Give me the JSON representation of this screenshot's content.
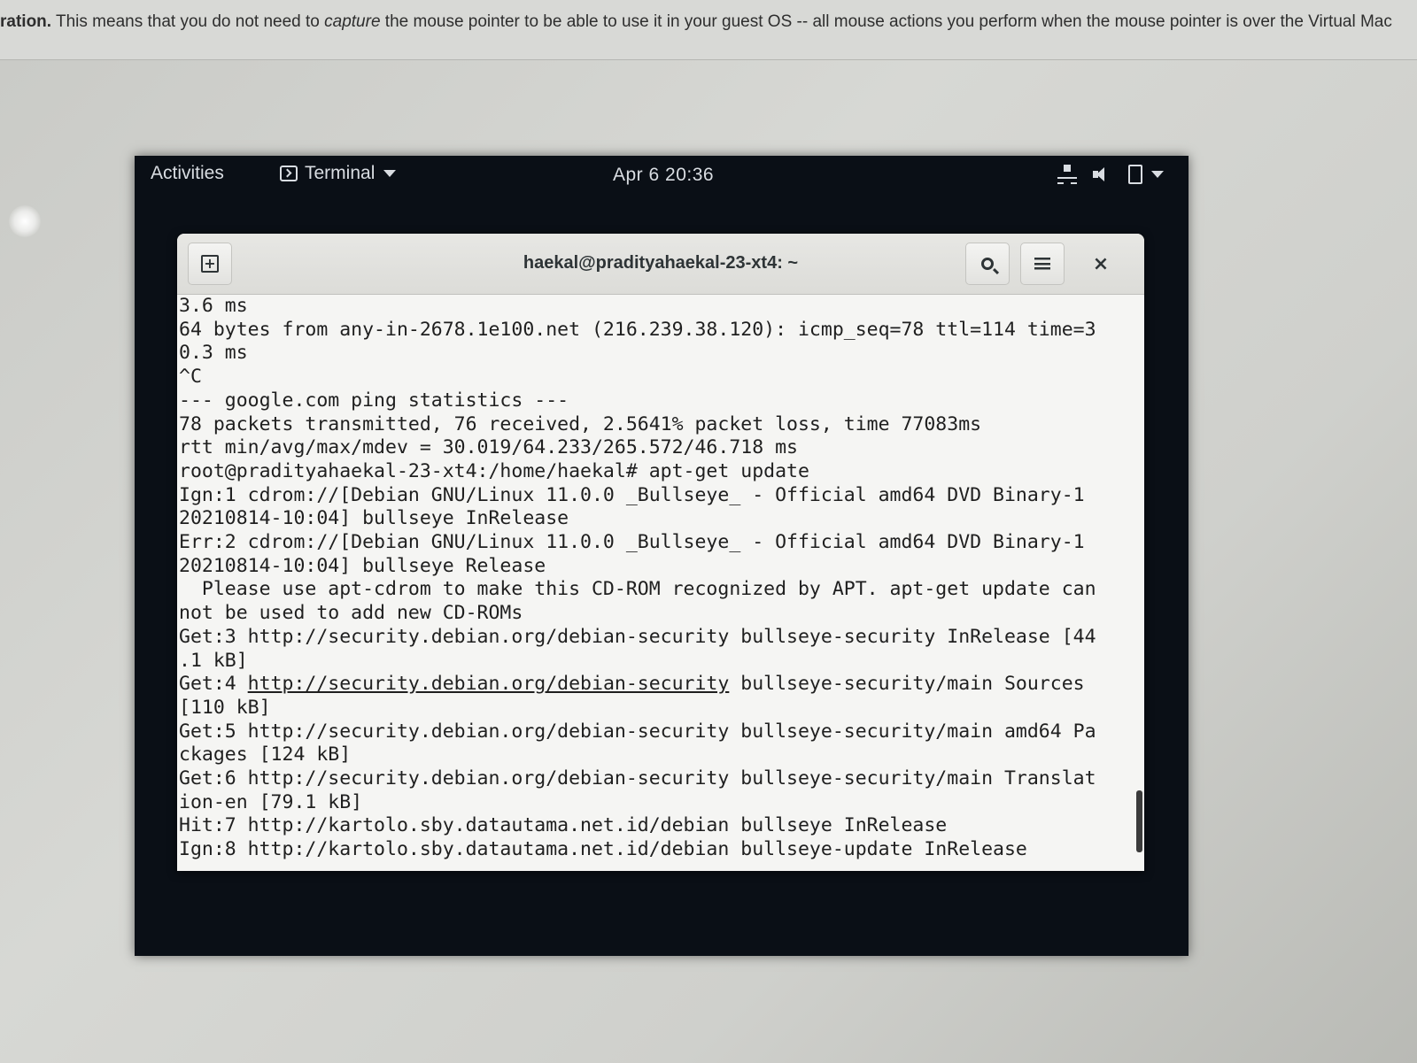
{
  "host_banner": {
    "bold": "ration.",
    "before_italic": " This means that you do not need to ",
    "italic": "capture",
    "after_italic": " the mouse pointer to be able to use it in your guest OS -- all mouse actions you perform when the mouse pointer is over the Virtual Mac"
  },
  "topbar": {
    "activities": "Activities",
    "app_menu": "Terminal",
    "clock": "Apr 6  20:36",
    "icons": [
      "network-icon",
      "volume-icon",
      "power-icon",
      "chevron-down-icon"
    ]
  },
  "terminal": {
    "title": "haekal@pradityahaekal-23-xt4: ~",
    "lines": [
      "3.6 ms",
      "64 bytes from any-in-2678.1e100.net (216.239.38.120): icmp_seq=78 ttl=114 time=3",
      "0.3 ms",
      "^C",
      "--- google.com ping statistics ---",
      "78 packets transmitted, 76 received, 2.5641% packet loss, time 77083ms",
      "rtt min/avg/max/mdev = 30.019/64.233/265.572/46.718 ms",
      "root@pradityahaekal-23-xt4:/home/haekal# apt-get update",
      "Ign:1 cdrom://[Debian GNU/Linux 11.0.0 _Bullseye_ - Official amd64 DVD Binary-1",
      "20210814-10:04] bullseye InRelease",
      "Err:2 cdrom://[Debian GNU/Linux 11.0.0 _Bullseye_ - Official amd64 DVD Binary-1",
      "20210814-10:04] bullseye Release",
      "  Please use apt-cdrom to make this CD-ROM recognized by APT. apt-get update can",
      "not be used to add new CD-ROMs",
      "Get:3 http://security.debian.org/debian-security bullseye-security InRelease [44",
      ".1 kB]",
      "Get:4 ",
      "[110 kB]",
      "Get:5 http://security.debian.org/debian-security bullseye-security/main amd64 Pa",
      "ckages [124 kB]",
      "Get:6 http://security.debian.org/debian-security bullseye-security/main Translat",
      "ion-en [79.1 kB]",
      "Hit:7 http://kartolo.sby.datautama.net.id/debian bullseye InRelease",
      "Ign:8 http://kartolo.sby.datautama.net.id/debian bullseye-update InRelease"
    ],
    "line17_link": "http://security.debian.org/debian-security",
    "line17_rest": " bullseye-security/main Sources"
  }
}
